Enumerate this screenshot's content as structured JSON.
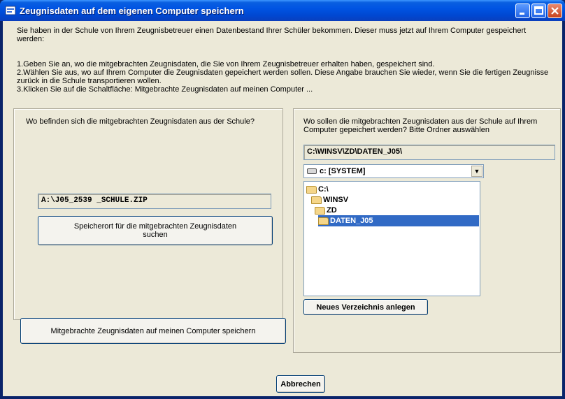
{
  "window": {
    "title": "Zeugnisdaten auf dem eigenen Computer speichern"
  },
  "intro": {
    "text": "Sie haben in der Schule von Ihrem Zeugnisbetreuer einen Datenbestand Ihrer Schüler bekommen. Dieser muss jetzt auf Ihrem Computer gespeichert werden:",
    "step1": "1.Geben Sie an, wo die mitgebrachten Zeugnisdaten, die Sie von Ihrem Zeugnisbetreuer erhalten haben, gespeichert sind.",
    "step2": "2.Wählen Sie aus, wo auf Ihrem Computer die Zeugnisdaten gepeichert werden sollen. Diese Angabe brauchen Sie wieder, wenn Sie die fertigen Zeugnisse zurück in die Schule transportieren wollen.",
    "step3": "3.Klicken Sie auf die Schaltfläche: Mitgebrachte Zeugnisdaten auf meinen Computer ..."
  },
  "source": {
    "question": "Wo befinden sich die mitgebrachten Zeugnisdaten aus der Schule?",
    "path": "A:\\J05_2539 _SCHULE.ZIP",
    "browse_button": "Speicherort für die mitgebrachten Zeugnisdaten suchen",
    "save_button": "Mitgebrachte Zeugnisdaten auf meinen Computer speichern"
  },
  "target": {
    "question": "Wo sollen die mitgebrachten Zeugnisdaten aus der Schule auf Ihrem Computer gepeichert werden? Bitte Ordner auswählen",
    "path": "C:\\WINSV\\ZD\\DATEN_J05\\",
    "drive": "c: [SYSTEM]",
    "tree": [
      "C:\\",
      "WINSV",
      "ZD",
      "DATEN_J05"
    ],
    "new_folder_button": "Neues Verzeichnis anlegen"
  },
  "footer": {
    "cancel_button": "Abbrechen"
  },
  "colors": {
    "titlebar": "#0054e3",
    "selection": "#316ac5",
    "window_bg": "#ece9d8"
  }
}
